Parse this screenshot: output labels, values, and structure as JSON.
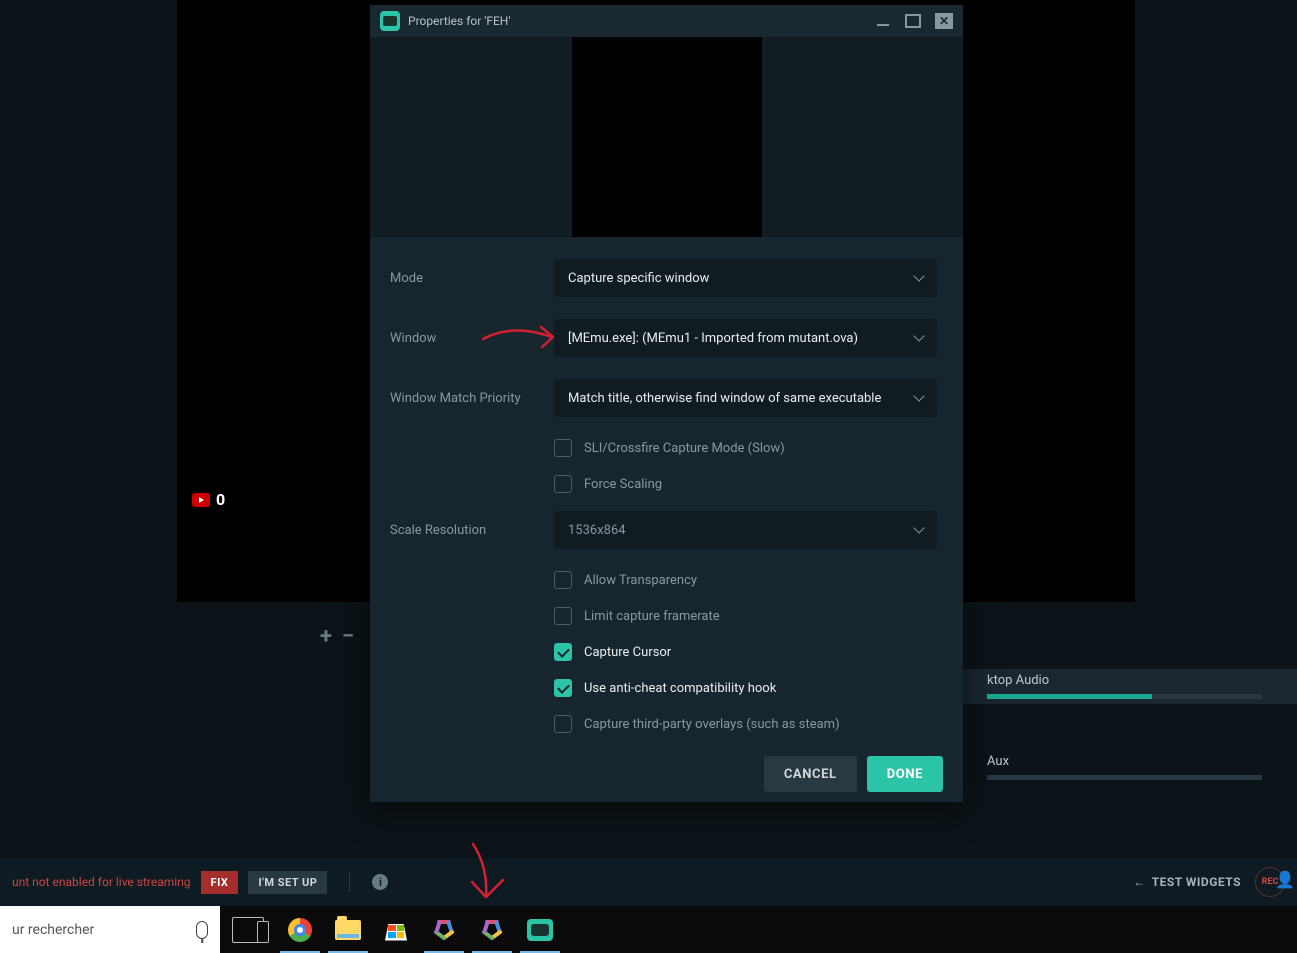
{
  "preview": {
    "viewer_count": "0"
  },
  "dialog": {
    "title": "Properties for 'FEH'",
    "labels": {
      "mode": "Mode",
      "window": "Window",
      "priority": "Window Match Priority",
      "scale": "Scale Resolution"
    },
    "values": {
      "mode": "Capture specific window",
      "window": "[MEmu.exe]: (MEmu1 - Imported from mutant.ova)",
      "priority": "Match title, otherwise find window of same executable",
      "scale": "1536x864"
    },
    "checks": {
      "sli": "SLI/Crossfire Capture Mode (Slow)",
      "force_scaling": "Force Scaling",
      "allow_transparency": "Allow Transparency",
      "limit_framerate": "Limit capture framerate",
      "capture_cursor": "Capture Cursor",
      "anticheat": "Use anti-cheat compatibility hook",
      "overlays": "Capture third-party overlays (such as steam)"
    },
    "buttons": {
      "cancel": "CANCEL",
      "done": "DONE"
    }
  },
  "mixer": {
    "desktop": "ktop Audio",
    "aux": "Aux"
  },
  "status": {
    "msg": "unt not enabled for live streaming",
    "fix": "FIX",
    "setup": "I'M SET UP",
    "test_widgets": "TEST WIDGETS",
    "rec": "REC"
  },
  "taskbar": {
    "search_placeholder": "ur rechercher"
  }
}
